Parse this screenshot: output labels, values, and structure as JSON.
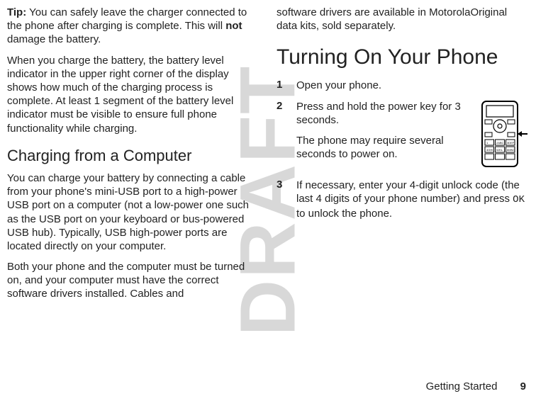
{
  "watermark": "DRAFT",
  "col1": {
    "tip_label": "Tip:",
    "tip_text": " You can safely leave the charger connected to the phone after charging is complete. This will ",
    "tip_bold": "not",
    "tip_text2": " damage the battery.",
    "para2": "When you charge the battery, the battery level indicator in the upper right corner of the display shows how much of the charging process is complete. At least 1 segment of the battery level indicator must be visible to ensure full phone functionality while charging.",
    "h2": "Charging from a Computer",
    "para3": "You can charge your battery by connecting a cable from your phone's mini-USB port to a high-power USB port on a computer (not a low-power one such as the USB port on your keyboard or bus-powered USB hub). Typically, USB high-power ports are located directly on your computer.",
    "para4": "Both your phone and the computer must be turned on, and your computer must have the correct software drivers installed. Cables and"
  },
  "col2": {
    "para_cont": "software drivers are available in MotorolaOriginal data kits, sold separately.",
    "h1": "Turning On Your Phone",
    "steps": {
      "s1": {
        "num": "1",
        "text": "Open your phone."
      },
      "s2": {
        "num": "2",
        "text": "Press and hold the power key for 3 seconds.",
        "sub": "The phone may require several seconds to power on."
      },
      "s3": {
        "num": "3",
        "text_a": "If necessary, enter your 4-digit unlock code (the last 4 digits of your phone number) and press ",
        "key": "OK",
        "text_b": " to unlock the phone."
      }
    }
  },
  "footer": {
    "section": "Getting Started",
    "page": "9"
  }
}
